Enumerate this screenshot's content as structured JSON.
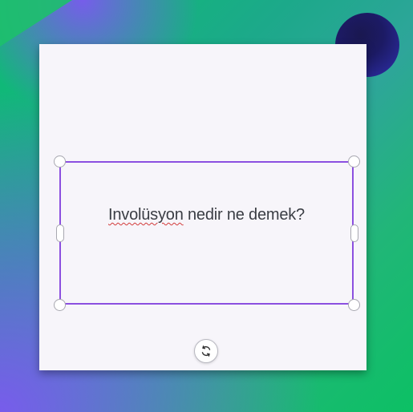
{
  "slide": {
    "title_misspelled_word": "Involüsyon",
    "title_rest": " nedir ne demek?"
  },
  "controls": {
    "rotate_icon": "rotate-icon"
  }
}
